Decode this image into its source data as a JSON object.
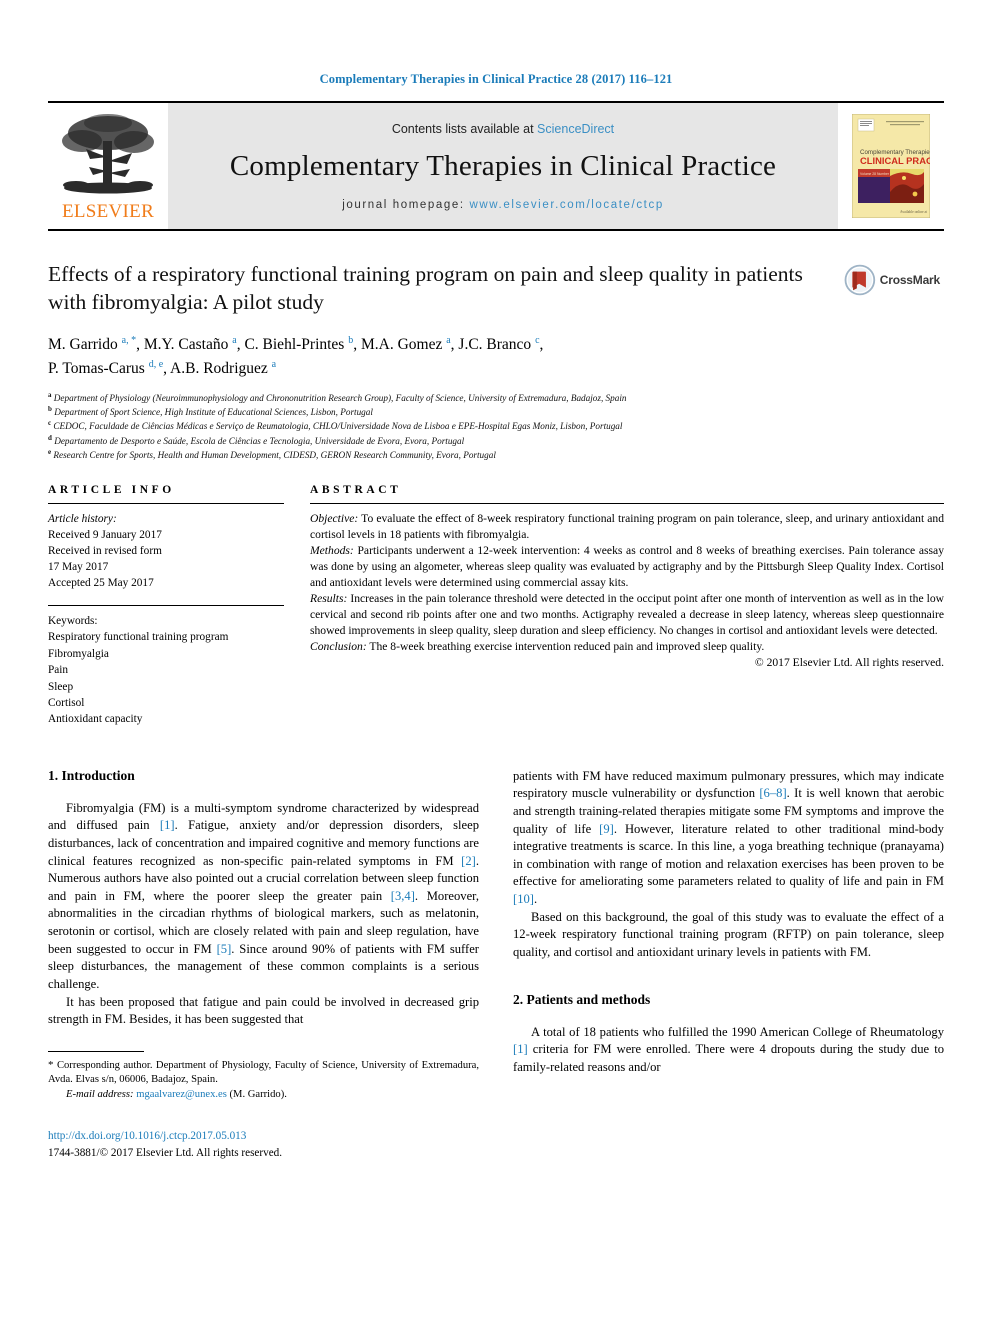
{
  "running_head": "Complementary Therapies in Clinical Practice 28 (2017) 116–121",
  "masthead": {
    "publisher": "ELSEVIER",
    "contents_prefix": "Contents lists available at ",
    "contents_link": "ScienceDirect",
    "journal_title": "Complementary Therapies in Clinical Practice",
    "homepage_prefix": "journal homepage: ",
    "homepage_url": "www.elsevier.com/locate/ctcp",
    "cover": {
      "line1": "Complementary Therapies in",
      "line2": "CLINICAL PRACTICE",
      "publisher_word": "ELSEVIER"
    }
  },
  "article": {
    "title": "Effects of a respiratory functional training program on pain and sleep quality in patients with fibromyalgia: A pilot study",
    "crossmark_label": "CrossMark",
    "authors": [
      {
        "name": "M. Garrido",
        "marks": "a, *"
      },
      {
        "name": "M.Y. Castaño",
        "marks": "a"
      },
      {
        "name": "C. Biehl-Printes",
        "marks": "b"
      },
      {
        "name": "M.A. Gomez",
        "marks": "a"
      },
      {
        "name": "J.C. Branco",
        "marks": "c"
      },
      {
        "name": "P. Tomas-Carus",
        "marks": "d, e"
      },
      {
        "name": "A.B. Rodriguez",
        "marks": "a"
      }
    ],
    "affiliations": [
      {
        "mark": "a",
        "text": "Department of Physiology (Neuroimmunophysiology and Chrononutrition Research Group), Faculty of Science, University of Extremadura, Badajoz, Spain"
      },
      {
        "mark": "b",
        "text": "Department of Sport Science, High Institute of Educational Sciences, Lisbon, Portugal"
      },
      {
        "mark": "c",
        "text": "CEDOC, Faculdade de Ciências Médicas e Serviço de Reumatologia, CHLO/Universidade Nova de Lisboa e EPE-Hospital Egas Moniz, Lisbon, Portugal"
      },
      {
        "mark": "d",
        "text": "Departamento de Desporto e Saúde, Escola de Ciências e Tecnologia, Universidade de Evora, Evora, Portugal"
      },
      {
        "mark": "e",
        "text": "Research Centre for Sports, Health and Human Development, CIDESD, GERON Research Community, Evora, Portugal"
      }
    ]
  },
  "article_info": {
    "heading": "ARTICLE INFO",
    "history_label": "Article history:",
    "history_lines": [
      "Received 9 January 2017",
      "Received in revised form",
      "17 May 2017",
      "Accepted 25 May 2017"
    ],
    "keywords_label": "Keywords:",
    "keywords": [
      "Respiratory functional training program",
      "Fibromyalgia",
      "Pain",
      "Sleep",
      "Cortisol",
      "Antioxidant capacity"
    ]
  },
  "abstract": {
    "heading": "ABSTRACT",
    "sections": [
      {
        "label": "Objective:",
        "text": " To evaluate the effect of 8-week respiratory functional training program on pain tolerance, sleep, and urinary antioxidant and cortisol levels in 18 patients with fibromyalgia."
      },
      {
        "label": "Methods:",
        "text": " Participants underwent a 12-week intervention: 4 weeks as control and 8 weeks of breathing exercises. Pain tolerance assay was done by using an algometer, whereas sleep quality was evaluated by actigraphy and by the Pittsburgh Sleep Quality Index. Cortisol and antioxidant levels were determined using commercial assay kits."
      },
      {
        "label": "Results:",
        "text": " Increases in the pain tolerance threshold were detected in the occiput point after one month of intervention as well as in the low cervical and second rib points after one and two months. Actigraphy revealed a decrease in sleep latency, whereas sleep questionnaire showed improvements in sleep quality, sleep duration and sleep efficiency. No changes in cortisol and antioxidant levels were detected."
      },
      {
        "label": "Conclusion:",
        "text": " The 8-week breathing exercise intervention reduced pain and improved sleep quality."
      }
    ],
    "copyright": "© 2017 Elsevier Ltd. All rights reserved."
  },
  "body": {
    "intro_heading": "1. Introduction",
    "methods_heading": "2. Patients and methods",
    "left_paragraphs": [
      "Fibromyalgia (FM) is a multi-symptom syndrome characterized by widespread and diffused pain [1]. Fatigue, anxiety and/or depression disorders, sleep disturbances, lack of concentration and impaired cognitive and memory functions are clinical features recognized as non-specific pain-related symptoms in FM [2]. Numerous authors have also pointed out a crucial correlation between sleep function and pain in FM, where the poorer sleep the greater pain [3,4]. Moreover, abnormalities in the circadian rhythms of biological markers, such as melatonin, serotonin or cortisol, which are closely related with pain and sleep regulation, have been suggested to occur in FM [5]. Since around 90% of patients with FM suffer sleep disturbances, the management of these common complaints is a serious challenge.",
      "It has been proposed that fatigue and pain could be involved in decreased grip strength in FM. Besides, it has been suggested that"
    ],
    "right_paragraphs": [
      "patients with FM have reduced maximum pulmonary pressures, which may indicate respiratory muscle vulnerability or dysfunction [6–8]. It is well known that aerobic and strength training-related therapies mitigate some FM symptoms and improve the quality of life [9]. However, literature related to other traditional mind-body integrative treatments is scarce. In this line, a yoga breathing technique (pranayama) in combination with range of motion and relaxation exercises has been proven to be effective for ameliorating some parameters related to quality of life and pain in FM [10].",
      "Based on this background, the goal of this study was to evaluate the effect of a 12-week respiratory functional training program (RFTP) on pain tolerance, sleep quality, and cortisol and antioxidant urinary levels in patients with FM."
    ],
    "methods_paragraph": "A total of 18 patients who fulfilled the 1990 American College of Rheumatology [1] criteria for FM were enrolled. There were 4 dropouts during the study due to family-related reasons and/or"
  },
  "footnotes": {
    "corresponding_star": "*",
    "corresponding_text": " Corresponding author. Department of Physiology, Faculty of Science, University of Extremadura, Avda. Elvas s/n, 06006, Badajoz, Spain.",
    "email_label": "E-mail address:",
    "email": "mgaalvarez@unex.es",
    "email_suffix": " (M. Garrido).",
    "doi": "http://dx.doi.org/10.1016/j.ctcp.2017.05.013",
    "issn_line": "1744-3881/© 2017 Elsevier Ltd. All rights reserved."
  },
  "colors": {
    "link": "#1a7bb9",
    "elsevier_orange": "#f07c1a",
    "masthead_grey": "#e6e6e6",
    "crossmark_red": "#c0392b"
  }
}
